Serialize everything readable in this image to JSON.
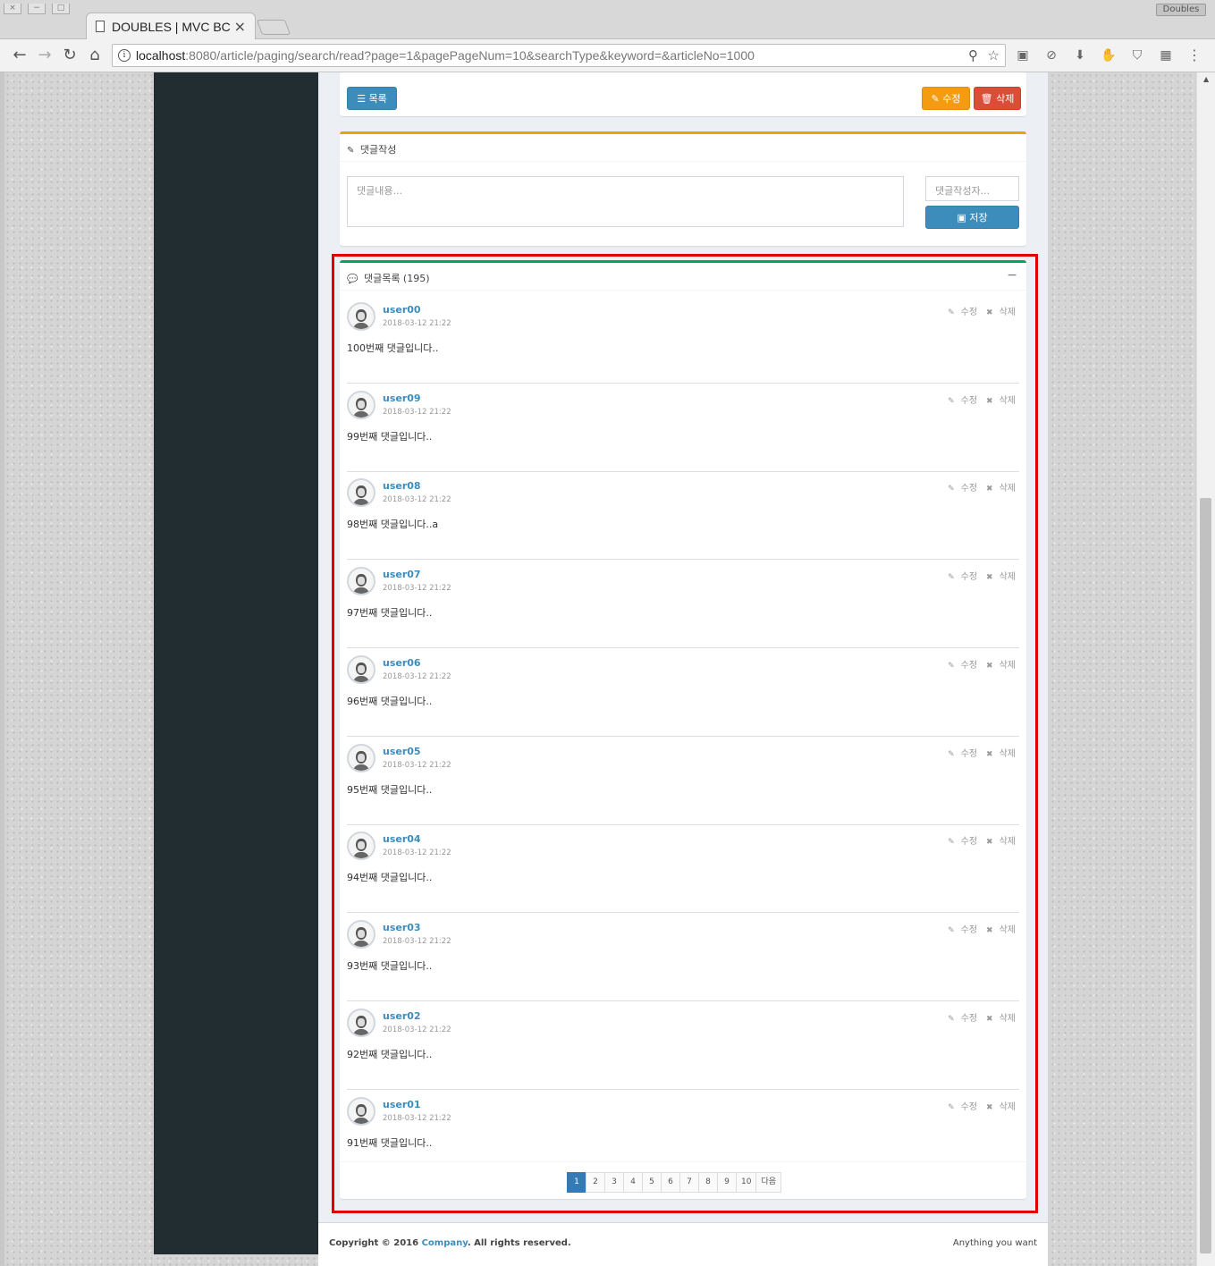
{
  "browser": {
    "tab_title": "DOUBLES | MVC BC",
    "tab_close": "×",
    "url_host": "localhost",
    "url_rest": ":8080/article/paging/search/read?page=1&pagePageNum=10&searchType&keyword=&articleNo=1000",
    "profile": "Doubles",
    "icons": {
      "back": "←",
      "forward": "→",
      "reload": "↻",
      "home": "⌂",
      "info": "i",
      "zoom": "⚲",
      "star": "☆",
      "ext1": "▣",
      "ext2": "⊘",
      "ext3": "⬇",
      "ext4": "✋",
      "ext5": "⛉",
      "ext6": "▦",
      "menu": "⋮"
    }
  },
  "article": {
    "list_button": "목록",
    "edit_button": "수정",
    "delete_button": "삭제",
    "list_icon": "☰",
    "edit_icon": "✎",
    "delete_icon": "🗑"
  },
  "reply_form": {
    "title": "댓글작성",
    "title_icon": "✎",
    "text_placeholder": "댓글내용...",
    "writer_placeholder": "댓글작성자...",
    "save_button": "저장",
    "save_icon": "▣"
  },
  "reply_list": {
    "title": "댓글목록 (195)",
    "title_icon": "💬",
    "collapse": "−",
    "edit_label": "수정",
    "delete_label": "삭제",
    "edit_icon": "✎",
    "delete_icon": "✖",
    "items": [
      {
        "user": "user00",
        "date": "2018-03-12 21:22",
        "text": "100번째 댓글입니다.."
      },
      {
        "user": "user09",
        "date": "2018-03-12 21:22",
        "text": "99번째 댓글입니다.."
      },
      {
        "user": "user08",
        "date": "2018-03-12 21:22",
        "text": "98번째 댓글입니다..a"
      },
      {
        "user": "user07",
        "date": "2018-03-12 21:22",
        "text": "97번째 댓글입니다.."
      },
      {
        "user": "user06",
        "date": "2018-03-12 21:22",
        "text": "96번째 댓글입니다.."
      },
      {
        "user": "user05",
        "date": "2018-03-12 21:22",
        "text": "95번째 댓글입니다.."
      },
      {
        "user": "user04",
        "date": "2018-03-12 21:22",
        "text": "94번째 댓글입니다.."
      },
      {
        "user": "user03",
        "date": "2018-03-12 21:22",
        "text": "93번째 댓글입니다.."
      },
      {
        "user": "user02",
        "date": "2018-03-12 21:22",
        "text": "92번째 댓글입니다.."
      },
      {
        "user": "user01",
        "date": "2018-03-12 21:22",
        "text": "91번째 댓글입니다.."
      }
    ],
    "pages": [
      "1",
      "2",
      "3",
      "4",
      "5",
      "6",
      "7",
      "8",
      "9",
      "10"
    ],
    "active_page": "1",
    "next_label": "다음"
  },
  "footer": {
    "copyright_prefix": "Copyright © 2016 ",
    "company": "Company",
    "copyright_suffix": ". All rights reserved.",
    "tagline": "Anything you want"
  },
  "colors": {
    "primary": "#3c8dbc",
    "warning": "#f39c12",
    "danger": "#dd4b39",
    "success": "#00a65a",
    "sidebar": "#222d32",
    "highlight": "#e00000"
  }
}
